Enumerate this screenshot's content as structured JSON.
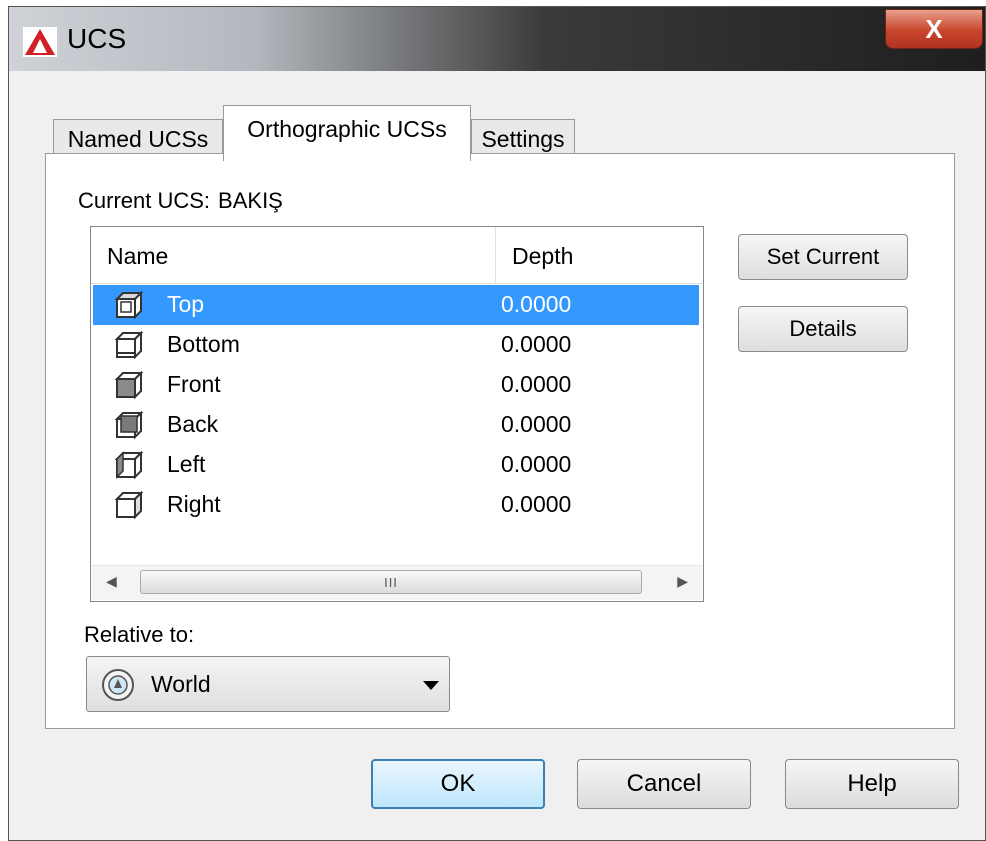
{
  "window": {
    "title": "UCS",
    "close_label": "X"
  },
  "tabs": [
    {
      "label": "Named UCSs",
      "active": false
    },
    {
      "label": "Orthographic UCSs",
      "active": true
    },
    {
      "label": "Settings",
      "active": false
    }
  ],
  "current_ucs": {
    "label": "Current UCS:",
    "value": "BAKIŞ"
  },
  "list": {
    "columns": [
      "Name",
      "Depth"
    ],
    "rows": [
      {
        "name": "Top",
        "depth": "0.0000",
        "icon": "ucs-top-icon",
        "selected": true
      },
      {
        "name": "Bottom",
        "depth": "0.0000",
        "icon": "ucs-bottom-icon",
        "selected": false
      },
      {
        "name": "Front",
        "depth": "0.0000",
        "icon": "ucs-front-icon",
        "selected": false
      },
      {
        "name": "Back",
        "depth": "0.0000",
        "icon": "ucs-back-icon",
        "selected": false
      },
      {
        "name": "Left",
        "depth": "0.0000",
        "icon": "ucs-left-icon",
        "selected": false
      },
      {
        "name": "Right",
        "depth": "0.0000",
        "icon": "ucs-right-icon",
        "selected": false
      }
    ],
    "scroll_thumb_grip": "III"
  },
  "buttons": {
    "set_current": "Set Current",
    "details": "Details",
    "ok": "OK",
    "cancel": "Cancel",
    "help": "Help"
  },
  "relative_to": {
    "label": "Relative to:",
    "value": "World",
    "icon": "world-ucs-icon"
  },
  "colors": {
    "selection": "#3399ff",
    "brand_logo": "#d01f25"
  }
}
